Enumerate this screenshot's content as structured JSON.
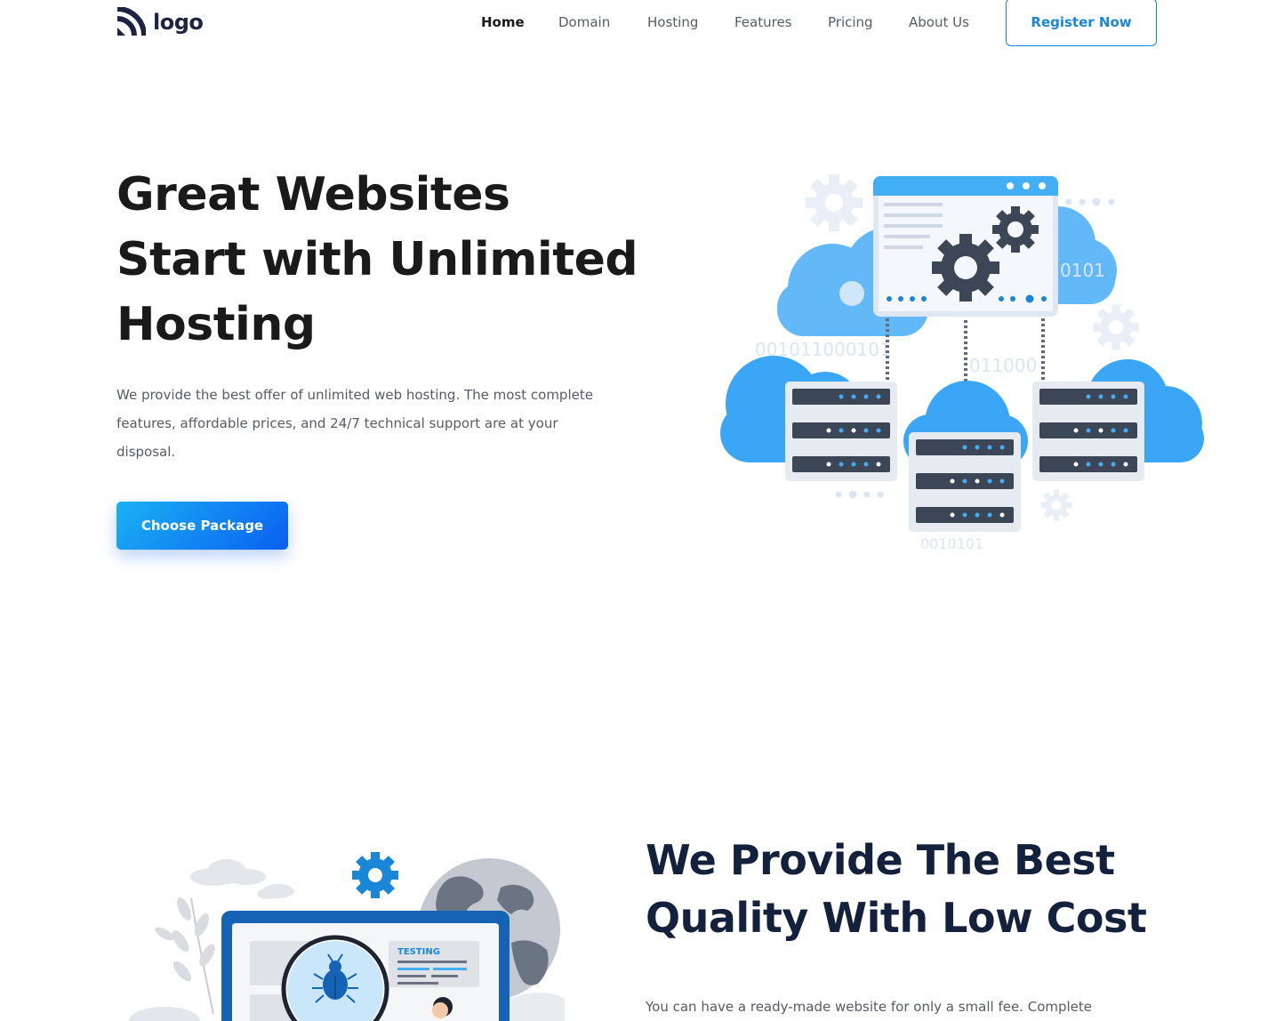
{
  "nav": {
    "logo_text": "logo",
    "items": [
      {
        "label": "Home",
        "active": true
      },
      {
        "label": "Domain",
        "active": false
      },
      {
        "label": "Hosting",
        "active": false
      },
      {
        "label": "Features",
        "active": false
      },
      {
        "label": "Pricing",
        "active": false
      },
      {
        "label": "About Us",
        "active": false
      }
    ],
    "register_label": "Register Now"
  },
  "hero": {
    "title": "Great Websites Start with Unlimited Hosting",
    "description": "We provide the best offer of unlimited web hosting. The most complete features, affordable prices, and 24/7 technical support are at your disposal.",
    "cta_label": "Choose Package",
    "illustration_texts": [
      "0101",
      "001011000101",
      "011000",
      "0010101"
    ]
  },
  "section2": {
    "title": "We Provide The Best Quality With Low Cost",
    "description": "You can have a ready-made website for only a small fee. Complete",
    "illustration_label": "TESTING"
  },
  "colors": {
    "accent": "#1a86d8",
    "cta_gradient_start": "#1ab2f5",
    "cta_gradient_end": "#0a5ff0",
    "heading_dark": "#14213d",
    "cloud_blue": "#42aef5",
    "server_dark": "#3d4656"
  },
  "icons": [
    "logo-mark-icon",
    "gear-icon",
    "cloud-icon",
    "server-icon",
    "bug-icon",
    "globe-icon",
    "magnifier-icon"
  ]
}
